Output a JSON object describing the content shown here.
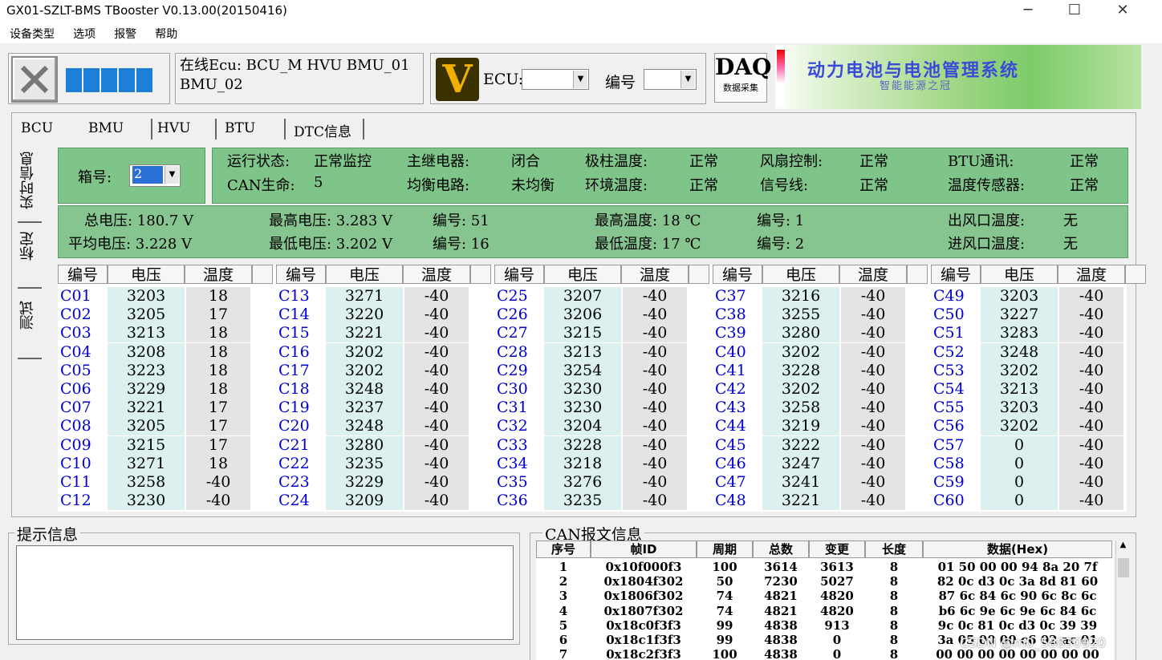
{
  "window": {
    "title": "GX01-SZLT-BMS TBooster V0.13.00(20150416)",
    "minimize": "─",
    "maximize": "☐",
    "close": "✕"
  },
  "menu": [
    "设备类型",
    "选项",
    "报警",
    "帮助"
  ],
  "toolbar": {
    "online_text": "在线Ecu: BCU_M HVU BMU_01 BMU_02",
    "ecu_label": "ECU:",
    "ecu_value": "",
    "number_label": "编号",
    "number_value": "",
    "daq_title": "DAQ",
    "daq_sub": "数据采集",
    "banner_line1": "动力电池与电池管理系统",
    "banner_line2": "智能能源之冠",
    "logo_letter": "V"
  },
  "tabs": [
    "BCU",
    "BMU",
    "HVU",
    "BTU",
    "DTC信息"
  ],
  "vtabs": [
    "实时信息",
    "标定",
    "测试"
  ],
  "bmu": {
    "box_label": "箱号:",
    "box_value": "2",
    "status_rows": [
      [
        {
          "label": "运行状态:",
          "value": "正常监控"
        },
        {
          "label": "主继电器:",
          "value": "闭合"
        },
        {
          "label": "极柱温度:",
          "value": "正常"
        },
        {
          "label": "风扇控制:",
          "value": "正常"
        },
        {
          "label": "BTU通讯:",
          "value": "正常"
        }
      ],
      [
        {
          "label": "CAN生命:",
          "value": "5"
        },
        {
          "label": "均衡电路:",
          "value": "未均衡"
        },
        {
          "label": "环境温度:",
          "value": "正常"
        },
        {
          "label": "信号线:",
          "value": "正常"
        },
        {
          "label": "温度传感器:",
          "value": "正常"
        }
      ]
    ],
    "summary": {
      "total_voltage": "总电压: 180.7 V",
      "avg_voltage": "平均电压: 3.228 V",
      "max_voltage": "最高电压: 3.283 V",
      "max_voltage_no": "编号: 51",
      "min_voltage": "最低电压: 3.202 V",
      "min_voltage_no": "编号: 16",
      "max_temp": "最高温度: 18 ℃",
      "max_temp_no": "编号: 1",
      "min_temp": "最低温度: 17 ℃",
      "min_temp_no": "编号: 2",
      "outlet_temp_label": "出风口温度:",
      "outlet_temp_value": "无",
      "inlet_temp_label": "进风口温度:",
      "inlet_temp_value": "无"
    },
    "col_headers": [
      "编号",
      "电压",
      "温度"
    ],
    "groups": [
      {
        "ids": [
          "C01",
          "C02",
          "C03",
          "C04",
          "C05",
          "C06",
          "C07",
          "C08",
          "C09",
          "C10",
          "C11",
          "C12"
        ],
        "volts": [
          "3203",
          "3205",
          "3213",
          "3208",
          "3223",
          "3229",
          "3221",
          "3205",
          "3215",
          "3271",
          "3258",
          "3230"
        ],
        "temps": [
          "18",
          "17",
          "18",
          "18",
          "18",
          "18",
          "17",
          "17",
          "17",
          "18",
          "-40",
          "-40"
        ]
      },
      {
        "ids": [
          "C13",
          "C14",
          "C15",
          "C16",
          "C17",
          "C18",
          "C19",
          "C20",
          "C21",
          "C22",
          "C23",
          "C24"
        ],
        "volts": [
          "3271",
          "3220",
          "3221",
          "3202",
          "3202",
          "3248",
          "3237",
          "3248",
          "3280",
          "3235",
          "3229",
          "3209"
        ],
        "temps": [
          "-40",
          "-40",
          "-40",
          "-40",
          "-40",
          "-40",
          "-40",
          "-40",
          "-40",
          "-40",
          "-40",
          "-40"
        ]
      },
      {
        "ids": [
          "C25",
          "C26",
          "C27",
          "C28",
          "C29",
          "C30",
          "C31",
          "C32",
          "C33",
          "C34",
          "C35",
          "C36"
        ],
        "volts": [
          "3207",
          "3206",
          "3215",
          "3213",
          "3254",
          "3230",
          "3230",
          "3204",
          "3228",
          "3218",
          "3276",
          "3235"
        ],
        "temps": [
          "-40",
          "-40",
          "-40",
          "-40",
          "-40",
          "-40",
          "-40",
          "-40",
          "-40",
          "-40",
          "-40",
          "-40"
        ]
      },
      {
        "ids": [
          "C37",
          "C38",
          "C39",
          "C40",
          "C41",
          "C42",
          "C43",
          "C44",
          "C45",
          "C46",
          "C47",
          "C48"
        ],
        "volts": [
          "3216",
          "3255",
          "3280",
          "3202",
          "3228",
          "3202",
          "3258",
          "3219",
          "3222",
          "3247",
          "3241",
          "3221"
        ],
        "temps": [
          "-40",
          "-40",
          "-40",
          "-40",
          "-40",
          "-40",
          "-40",
          "-40",
          "-40",
          "-40",
          "-40",
          "-40"
        ]
      },
      {
        "ids": [
          "C49",
          "C50",
          "C51",
          "C52",
          "C53",
          "C54",
          "C55",
          "C56",
          "C57",
          "C58",
          "C59",
          "C60"
        ],
        "volts": [
          "3203",
          "3227",
          "3283",
          "3248",
          "3202",
          "3213",
          "3203",
          "3202",
          "0",
          "0",
          "0",
          "0"
        ],
        "temps": [
          "-40",
          "-40",
          "-40",
          "-40",
          "-40",
          "-40",
          "-40",
          "-40",
          "-40",
          "-40",
          "-40",
          "-40"
        ]
      }
    ]
  },
  "hint": {
    "label": "提示信息",
    "text": ""
  },
  "can": {
    "label": "CAN报文信息",
    "headers": [
      "序号",
      "帧ID",
      "周期",
      "总数",
      "变更",
      "长度",
      "数据(Hex)"
    ],
    "rows": [
      [
        "1",
        "0x10f000f3",
        "100",
        "3614",
        "3613",
        "8",
        "01 50 00 00 94 8a 20 7f"
      ],
      [
        "2",
        "0x1804f302",
        "50",
        "7230",
        "5027",
        "8",
        "82 0c d3 0c 3a 8d 81 60"
      ],
      [
        "3",
        "0x1806f302",
        "74",
        "4821",
        "4820",
        "8",
        "87 6c 84 6c 90 6c 8c 6c"
      ],
      [
        "4",
        "0x1807f302",
        "74",
        "4821",
        "4820",
        "8",
        "b6 6c 9e 6c 9e 6c 84 6c"
      ],
      [
        "5",
        "0x18c0f3f3",
        "99",
        "4838",
        "913",
        "8",
        "9c 0c 81 0c d3 0c 39 39"
      ],
      [
        "6",
        "0x18c1f3f3",
        "99",
        "4838",
        "0",
        "8",
        "3a 05 00 00 c6 02 ac 01"
      ],
      [
        "7",
        "0x18c2f3f3",
        "100",
        "4838",
        "0",
        "8",
        "00 00 00 00 00 00 00 00"
      ]
    ]
  },
  "watermark": "CSDN @m0_58830920"
}
